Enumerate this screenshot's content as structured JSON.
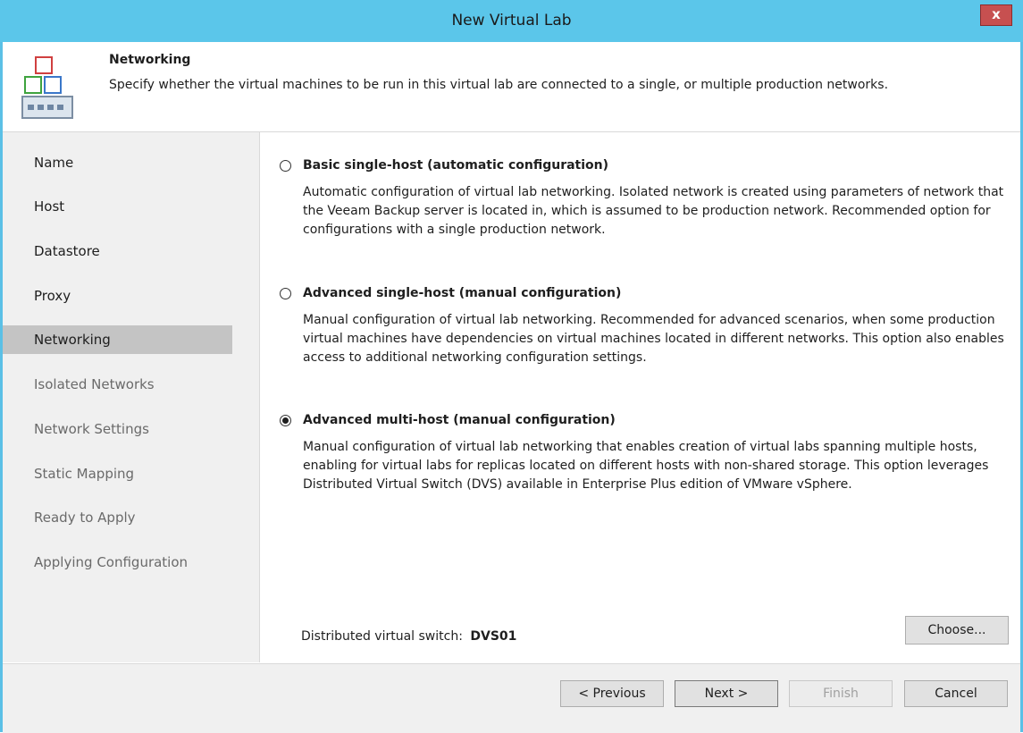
{
  "window": {
    "title": "New Virtual Lab",
    "close_label": "x"
  },
  "header": {
    "title": "Networking",
    "description": "Specify whether the virtual machines to be run in this virtual lab are connected to a single, or multiple production networks."
  },
  "sidebar": {
    "items": [
      {
        "label": "Name",
        "state": "normal"
      },
      {
        "label": "Host",
        "state": "normal"
      },
      {
        "label": "Datastore",
        "state": "normal"
      },
      {
        "label": "Proxy",
        "state": "normal"
      },
      {
        "label": "Networking",
        "state": "active"
      },
      {
        "label": "Isolated Networks",
        "state": "disabled"
      },
      {
        "label": "Network Settings",
        "state": "disabled"
      },
      {
        "label": "Static Mapping",
        "state": "disabled"
      },
      {
        "label": "Ready to Apply",
        "state": "disabled"
      },
      {
        "label": "Applying Configuration",
        "state": "disabled"
      }
    ]
  },
  "options": [
    {
      "label": "Basic single-host (automatic configuration)",
      "checked": false,
      "description": "Automatic configuration of virtual lab networking. Isolated network is created using parameters of network that the Veeam Backup server is located in, which is assumed to be production network. Recommended option for configurations with a single production network."
    },
    {
      "label": "Advanced single-host (manual configuration)",
      "checked": false,
      "description": "Manual configuration of virtual lab networking. Recommended for advanced scenarios, when some production virtual machines have dependencies on virtual machines located in different networks. This option also enables access to additional networking configuration settings."
    },
    {
      "label": "Advanced multi-host (manual configuration)",
      "checked": true,
      "description": "Manual configuration of virtual lab networking that enables creation of virtual labs spanning multiple hosts, enabling for virtual labs for replicas located on different hosts with non-shared storage. This option leverages Distributed Virtual Switch (DVS) available in Enterprise Plus edition of VMware vSphere."
    }
  ],
  "dvs": {
    "label": "Distributed virtual switch:",
    "value": "DVS01",
    "choose_label": "Choose..."
  },
  "footer": {
    "previous_label": "< Previous",
    "next_label": "Next >",
    "finish_label": "Finish",
    "cancel_label": "Cancel"
  },
  "colors": {
    "titlebar": "#5bc6ea",
    "close": "#c75050",
    "active_nav": "#c4c4c4"
  },
  "icons": {
    "header": "networking-icon",
    "close": "close-icon"
  }
}
